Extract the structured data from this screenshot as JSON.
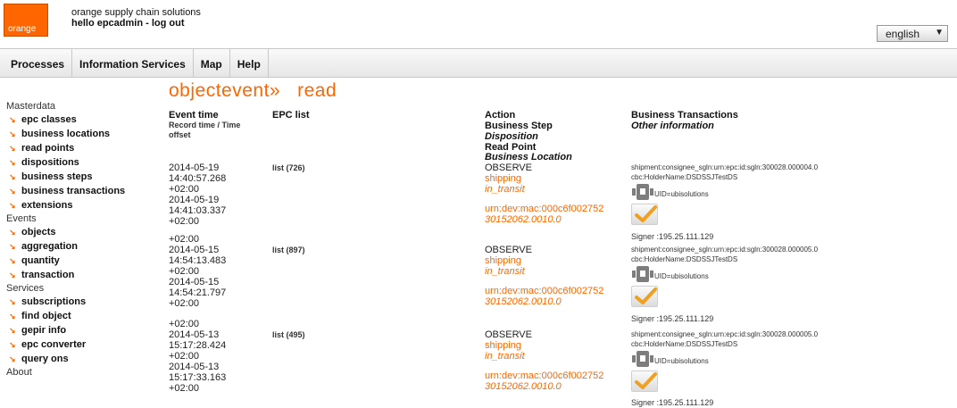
{
  "header": {
    "logo_text": "orange",
    "company": "orange supply chain solutions",
    "greeting": "hello epcadmin - log out",
    "language": "english"
  },
  "nav": {
    "tabs": [
      "Processes",
      "Information Services",
      "Map",
      "Help"
    ]
  },
  "sidebar": {
    "masterdata_label": "Masterdata",
    "masterdata_items": [
      "epc classes",
      "business locations",
      "read points",
      "dispositions",
      "business steps",
      "business transactions",
      "extensions"
    ],
    "events_label": "Events",
    "events_items": [
      "objects",
      "aggregation",
      "quantity",
      "transaction"
    ],
    "services_label": "Services",
    "services_items": [
      "subscriptions",
      "find object",
      "gepir info",
      "epc converter",
      "query ons"
    ],
    "about_label": "About"
  },
  "page_title": "objectevent»   read",
  "columns": {
    "event_time": "Event time",
    "record_time": "Record time / Time offset",
    "record_time_l1": "Record time / Time",
    "record_time_l2": "offset",
    "epc_list": "EPC list",
    "action": "Action",
    "business_step": "Business Step",
    "disposition": "Disposition",
    "read_point": "Read Point",
    "business_location": "Business Location",
    "business_transactions": "Business Transactions",
    "other_information": "Other information"
  },
  "leading_offset": "+02:00",
  "rows": [
    {
      "event_date": "2014-05-19",
      "event_time": "14:40:57.268",
      "event_offset": "+02:00",
      "record_date": "2014-05-19",
      "record_time": "14:41:03.337",
      "record_offset": "+02:00",
      "epc_list": "list (726)",
      "action": "OBSERVE",
      "business_step": "shipping",
      "disposition": "in_transit",
      "read_point_l1": "urn:dev:mac:000c6f002752",
      "read_point_l2": "30152062.0010.0",
      "biz_transaction": "shipment:consignee_sgln:urn:epc:id:sgln:300028.000004.0",
      "holder": "cbc:HolderName:DSDSSJTestDS",
      "uid": "UID=ubisolutions",
      "signer": "Signer :195.25.111.129",
      "trailing_offset": "+02:00"
    },
    {
      "event_date": "2014-05-15",
      "event_time": "14:54:13.483",
      "event_offset": "+02:00",
      "record_date": "2014-05-15",
      "record_time": "14:54:21.797",
      "record_offset": "+02:00",
      "epc_list": "list (897)",
      "action": "OBSERVE",
      "business_step": "shipping",
      "disposition": "in_transit",
      "read_point_l1": "urn:dev:mac:000c6f002752",
      "read_point_l2": "30152062.0010.0",
      "biz_transaction": "shipment:consignee_sgln:urn:epc:id:sgln:300028.000005.0",
      "holder": "cbc:HolderName:DSDSSJTestDS",
      "uid": "UID=ubisolutions",
      "signer": "Signer :195.25.111.129",
      "trailing_offset": "+02:00"
    },
    {
      "event_date": "2014-05-13",
      "event_time": "15:17:28.424",
      "event_offset": "+02:00",
      "record_date": "2014-05-13",
      "record_time": "15:17:33.163",
      "record_offset": "+02:00",
      "epc_list": "list (495)",
      "action": "OBSERVE",
      "business_step": "shipping",
      "disposition": "in_transit",
      "read_point_l1": "urn:dev:mac:000c6f002752",
      "read_point_l2": "30152062.0010.0",
      "biz_transaction": "shipment:consignee_sgln:urn:epc:id:sgln:300028.000005.0",
      "holder": "cbc:HolderName:DSDSSJTestDS",
      "uid": "UID=ubisolutions",
      "signer": "Signer :195.25.111.129",
      "trailing_offset": ""
    }
  ],
  "colors": {
    "accent": "#ff6600",
    "nav_bg": "#eeeeee",
    "text": "#222222"
  },
  "icons": [
    "certificate-icon",
    "checkmark-icon",
    "arrow-bullet-icon",
    "dropdown-arrow-icon"
  ]
}
